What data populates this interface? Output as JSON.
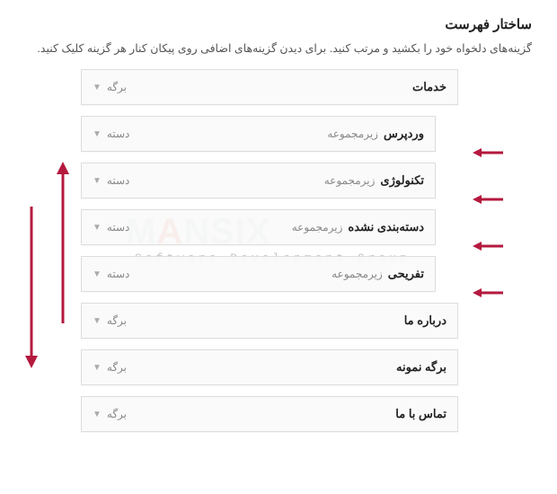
{
  "heading": "ساختار فهرست",
  "description": "گزینه‌های دلخواه خود را بکشید و مرتب کنید. برای دیدن گزینه‌های اضافی روی پیکان کنار هر گزینه کلیک کنید.",
  "sub_label": "زیرمجموعه",
  "type_labels": {
    "page": "برگه",
    "category": "دسته"
  },
  "items": [
    {
      "title": "خدمات",
      "type": "page",
      "level": 0
    },
    {
      "title": "وردپرس",
      "type": "category",
      "level": 1,
      "sub": true,
      "pointed": true
    },
    {
      "title": "تکنولوژی",
      "type": "category",
      "level": 1,
      "sub": true,
      "pointed": true
    },
    {
      "title": "دسته‌بندی نشده",
      "type": "category",
      "level": 1,
      "sub": true,
      "pointed": true
    },
    {
      "title": "تفریحی",
      "type": "category",
      "level": 1,
      "sub": true,
      "pointed": true
    },
    {
      "title": "درباره ما",
      "type": "page",
      "level": 0
    },
    {
      "title": "برگه نمونه",
      "type": "page",
      "level": 0
    },
    {
      "title": "تماس با ما",
      "type": "page",
      "level": 0
    }
  ],
  "watermark": {
    "brand_html": "M<i>A</i>NSIX",
    "tagline": "Software Development Group"
  },
  "annotation_arrows": {
    "horizontal_count": 4,
    "vertical_up": true,
    "vertical_down": true
  },
  "colors": {
    "arrow": "#b5193e",
    "border": "#dddddd",
    "bg_item": "#fafafa"
  }
}
